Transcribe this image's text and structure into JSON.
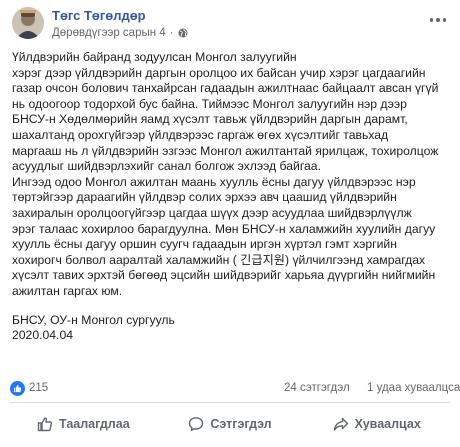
{
  "post": {
    "author_name": "Төгс Төгөлдөр",
    "timestamp": "Дөрөвдүгээр сарын 4",
    "audience_icon": "globe-icon",
    "body_paragraph_1": [
      "Үйлдвэрийн байранд зодуулсан Монгол залуугийн",
      "хэрэг дээр үйлдвэрийн даргын оролцоо их байсан учир хэрэг цагдаагийн",
      "газар очсон болович танхайрсан гадаадын ажилтнаас байцаалт авсан үгүй",
      "нь одоогоор тодорхой бус байна. Тиймээс Монгол залуугийн нэр дээр",
      "БНСУ-н Хөдөлмөрийн яамд хүсэлт тавьж үйлдвэрийн даргын дарамт,",
      "шахалтанд орохгүйгээр үйлдвэрээс гаргаж өгөх хүсэлтийг тавьхад",
      "маргааш нь л үйлдвэрийн эзгээс Монгол ажилтантай ярилцаж, тохиролцож",
      "асуудлыг шийдвэрлэхийг санал болгож эхлээд байгаа."
    ],
    "body_paragraph_2": [
      "Ингээд одоо Монгол ажилтан маань хуулль ёсны дагуу үйлдвэрээс нэр",
      "төртэйгээр дараагийн үйлдвэр солих эрхээ авч цаашид үйлдвэрийн",
      "захиралын оролцоогүйгээр цагдаа шүүх дээр асуудлаа шийдвэрлүүлж",
      "эрэг талаас хохирлоо барагдуулна. Мөн БНСУ-н халамжийн хуулийн дагуу",
      "хуулль ёсны дагуу оршин суугч гадаадын иргэн хүртэл гэмт хэргийн",
      "хохирогч болвол ааралтай халамжийн ( 긴급지원) үйлчилгээнд хамрагдах",
      "хүсэлт тавих эрхтэй бөгөөд эцсийн шийдвэрийг харьяа дүүргийн нийгмийн",
      "ажилтан гаргах юм."
    ],
    "signature": "БНСУ, ОУ-н Монгол сургууль",
    "date": "2020.04.04"
  },
  "stats": {
    "like_count": "215",
    "comments": "24 сэтгэгдэл",
    "shares": "1 удаа хуваалцсан"
  },
  "actions": {
    "like_label": "Таалагдлаа",
    "comment_label": "Сэтгэгдэл",
    "share_label": "Хуваалцах"
  },
  "colors": {
    "author_link": "#385898",
    "like_blue": "#2078f4",
    "muted_text": "#65676b",
    "action_text": "#606770"
  }
}
